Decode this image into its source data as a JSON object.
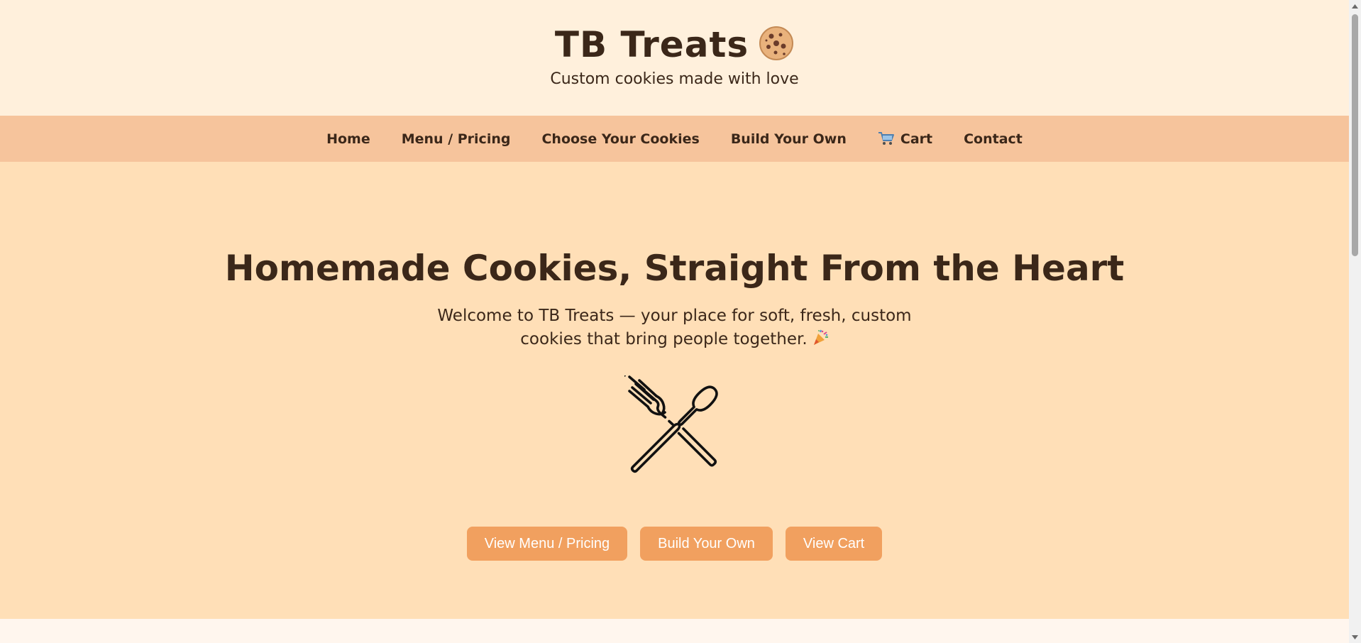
{
  "header": {
    "brand": "TB Treats",
    "brand_icon": "cookie-icon",
    "tagline": "Custom cookies made with love"
  },
  "nav": {
    "items": [
      {
        "label": "Home"
      },
      {
        "label": "Menu / Pricing"
      },
      {
        "label": "Choose Your Cookies"
      },
      {
        "label": "Build Your Own"
      },
      {
        "label": "Cart",
        "icon": "shopping-cart-icon"
      },
      {
        "label": "Contact"
      }
    ]
  },
  "hero": {
    "title": "Homemade Cookies, Straight From the Heart",
    "subtitle": "Welcome to TB Treats — your place for soft, fresh, custom cookies that bring people together.",
    "subtitle_icon": "party-popper-icon",
    "image_icon": "fork-and-spoon-icon",
    "buttons": [
      {
        "label": "View Menu / Pricing"
      },
      {
        "label": "Build Your Own"
      },
      {
        "label": "View Cart"
      }
    ]
  },
  "colors": {
    "header_bg": "#fff0dc",
    "nav_bg": "#f6c49c",
    "hero_bg": "#ffdfb7",
    "button_bg": "#f1a05f",
    "text": "#3b2719"
  }
}
